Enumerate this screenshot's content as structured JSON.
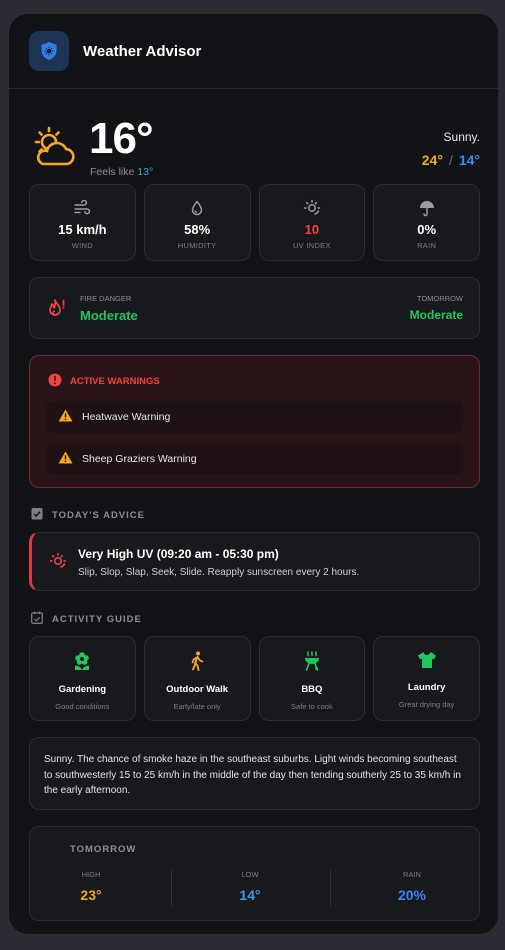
{
  "header": {
    "title": "Weather Advisor"
  },
  "current": {
    "temp": "16°",
    "feels_label": "Feels like ",
    "feels_value": "13°",
    "condition": "Sunny.",
    "high": "24°",
    "low": "14°",
    "separator": "/"
  },
  "stats": [
    {
      "value": "15 km/h",
      "label": "WIND",
      "icon": "wind-icon"
    },
    {
      "value": "58%",
      "label": "HUMIDITY",
      "icon": "droplet-icon"
    },
    {
      "value": "10",
      "label": "UV INDEX",
      "icon": "uv-sun-icon"
    },
    {
      "value": "0%",
      "label": "RAIN",
      "icon": "umbrella-icon"
    }
  ],
  "fire": {
    "label": "FIRE DANGER",
    "value": "Moderate",
    "tomorrow_label": "TOMORROW",
    "tomorrow_value": "Moderate"
  },
  "warnings": {
    "title": "ACTIVE WARNINGS",
    "items": [
      "Heatwave Warning",
      "Sheep Graziers Warning"
    ]
  },
  "advice": {
    "section_title": "TODAY'S ADVICE",
    "title": "Very High UV (09:20 am - 05:30 pm)",
    "desc": "Slip, Slop, Slap, Seek, Slide. Reapply sunscreen every 2 hours."
  },
  "activities": {
    "section_title": "ACTIVITY GUIDE",
    "items": [
      {
        "name": "Gardening",
        "status": "Good conditions",
        "icon": "flower-icon"
      },
      {
        "name": "Outdoor Walk",
        "status": "Early/late only",
        "icon": "walking-icon"
      },
      {
        "name": "BBQ",
        "status": "Safe to cook",
        "icon": "grill-icon"
      },
      {
        "name": "Laundry",
        "status": "Great drying day",
        "icon": "shirt-icon"
      }
    ]
  },
  "forecast": {
    "text": "Sunny. The chance of smoke haze in the southeast suburbs. Light winds becoming southeast to southwesterly 15 to 25 km/h in the middle of the day then tending southerly 25 to 35 km/h in the early afternoon."
  },
  "tomorrow": {
    "title": "TOMORROW",
    "high_label": "HIGH",
    "high": "23°",
    "low_label": "LOW",
    "low": "14°",
    "rain_label": "RAIN",
    "rain": "20%"
  },
  "colors": {
    "accent_orange": "#f5a623",
    "accent_blue": "#3b8bf0",
    "danger": "#f04438",
    "success": "#22c55e"
  }
}
